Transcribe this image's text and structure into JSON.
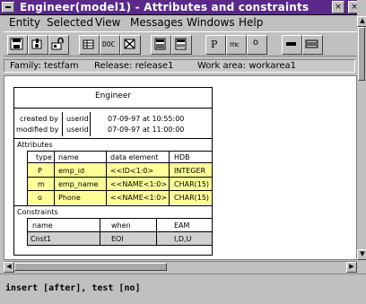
{
  "window": {
    "title": "Engineer(model1) - Attributes and constraints",
    "minimize_glyph": "×",
    "close_glyph": "×"
  },
  "menu": [
    {
      "label": "Entity"
    },
    {
      "label": "Selected"
    },
    {
      "label": "View"
    },
    {
      "label": "Messages"
    },
    {
      "label": "Windows"
    },
    {
      "label": "Help"
    }
  ],
  "toolbar": {
    "icons": [
      "save-icon",
      "select-icon",
      "lock-icon",
      "table-icon",
      "doc-icon",
      "delete-icon",
      "panel-icon",
      "panel-list-icon",
      "pointer-icon",
      "rename-icon",
      "move-icon",
      "collapse-icon",
      "expand-icon"
    ],
    "label_a": "o",
    "label_b": "▭",
    "label_c": "▭▭"
  },
  "infobar": {
    "family": "Family: testfam",
    "release": "Release: release1",
    "workarea": "Work area: workarea1"
  },
  "entity": {
    "name": "Engineer",
    "created_label": "created by",
    "created_user": "userid",
    "created_time": "07-09-97 at 10:55:00",
    "modified_label": "modified by",
    "modified_user": "userid",
    "modified_time": "07-09-97 at 11:00:00",
    "attributes_heading": "Attributes",
    "attr_columns": [
      "type",
      "name",
      "data element",
      "HDB"
    ],
    "attributes": [
      {
        "type": "P",
        "name": "emp_id",
        "element": "<<ID<1:0>",
        "hdb": "INTEGER"
      },
      {
        "type": "m",
        "name": "emp_name",
        "element": "<<NAME<1:0>",
        "hdb": "CHAR(15)"
      },
      {
        "type": "o",
        "name": "Phone",
        "element": "<<NAME<1:0>",
        "hdb": "CHAR(15)"
      }
    ],
    "constraints_heading": "Constraints",
    "cons_columns": [
      "name",
      "when",
      "EAM"
    ],
    "constraints": [
      {
        "name": "Cnst1",
        "when": "EOI",
        "eam": "I,D,U"
      }
    ]
  },
  "status": {
    "text": "insert [after], test [no]"
  }
}
